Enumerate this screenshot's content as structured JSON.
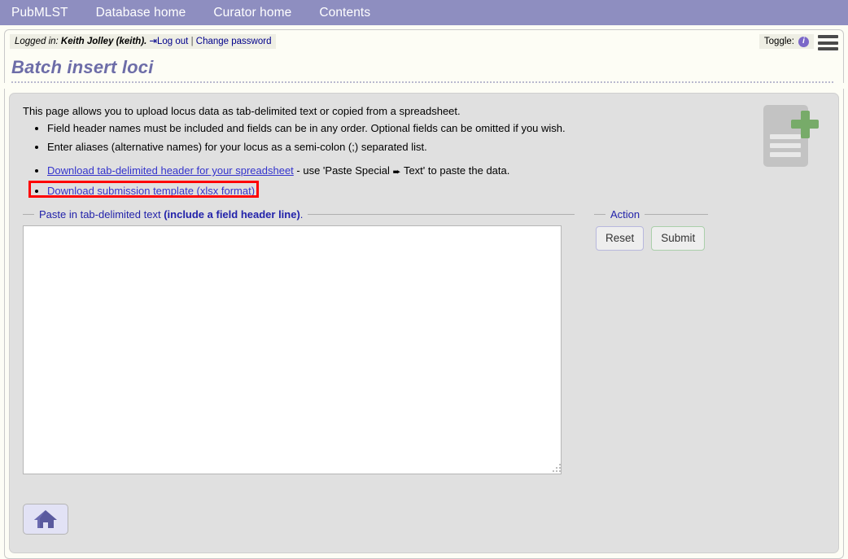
{
  "nav": {
    "items": [
      {
        "label": "PubMLST"
      },
      {
        "label": "Database home"
      },
      {
        "label": "Curator home"
      },
      {
        "label": "Contents"
      }
    ]
  },
  "header": {
    "logged_in_prefix": "Logged in:",
    "user": "Keith Jolley (keith).",
    "logout_icon": "logout-icon",
    "logout_label": "Log out",
    "separator": "|",
    "change_password_label": "Change password",
    "toggle_label": "Toggle:",
    "info_icon_glyph": "i",
    "menu_icon": "hamburger-menu-icon"
  },
  "page": {
    "title": "Batch insert loci"
  },
  "content": {
    "intro": "This page allows you to upload locus data as tab-delimited text or copied from a spreadsheet.",
    "bullets": [
      "Field header names must be included and fields can be in any order. Optional fields can be omitted if you wish.",
      "Enter aliases (alternative names) for your locus as a semi-colon (;) separated list."
    ],
    "download_header_link": "Download tab-delimited header for your spreadsheet",
    "download_header_suffix_before": " - use 'Paste Special ",
    "download_header_arrow": "⮕",
    "download_header_suffix_after": " Text' to paste the data.",
    "download_template_link": "Download submission template (xlsx format)",
    "highlight_color": "#ff0000",
    "doc_icon": "file-plus-icon"
  },
  "paste": {
    "legend_text": "Paste in tab-delimited text ",
    "legend_bold": "(include a field header line)",
    "legend_suffix": ".",
    "value": "",
    "placeholder": ""
  },
  "action": {
    "legend": "Action",
    "reset_label": "Reset",
    "submit_label": "Submit"
  },
  "footer": {
    "home_icon": "home-icon"
  },
  "colors": {
    "navbar": "#8e8ec0",
    "title": "#6d6da8",
    "link": "#3333cc",
    "panel_bg": "#e0e0e0",
    "page_bg": "#fdfdf5",
    "accent_green": "#77ab69",
    "accent_purple": "#7b68c8"
  }
}
